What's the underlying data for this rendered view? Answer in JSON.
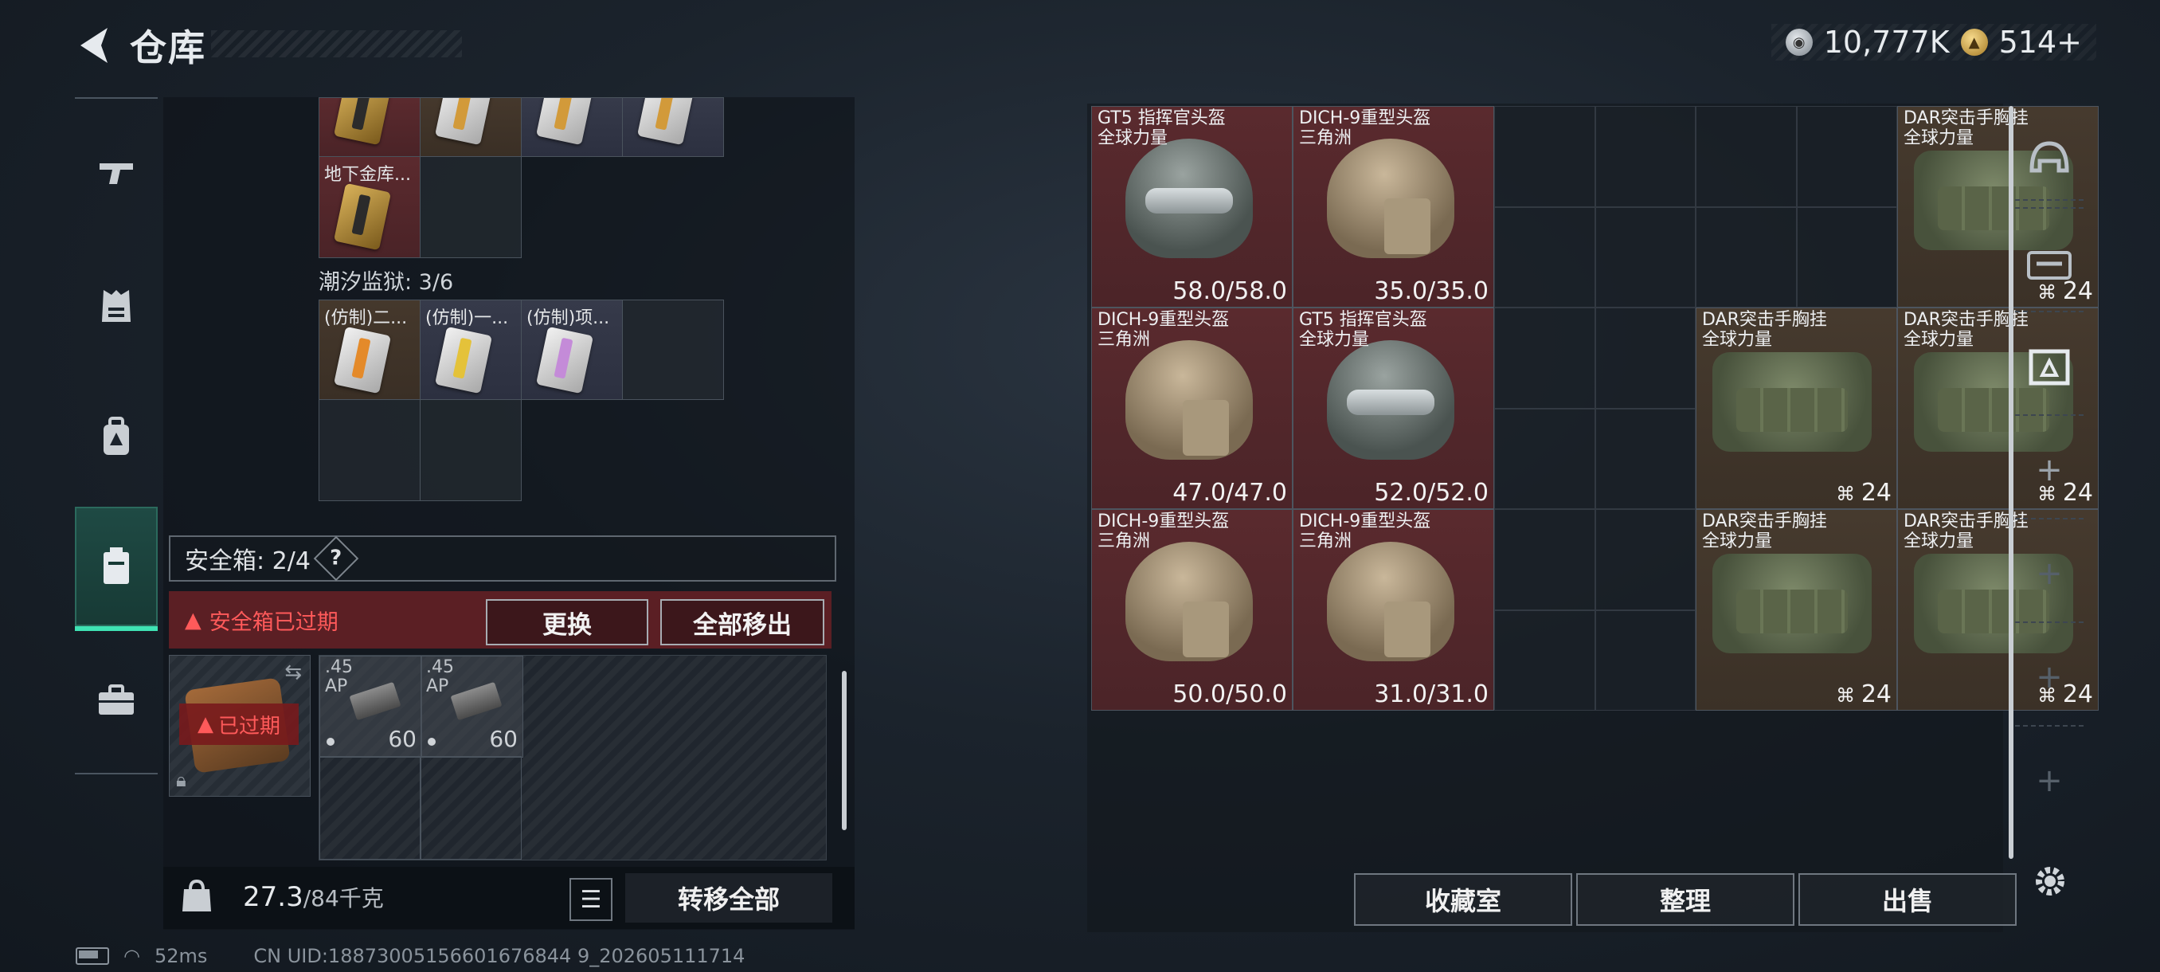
{
  "header": {
    "title": "仓库"
  },
  "currency": {
    "silver": "10,777K",
    "gold": "514+"
  },
  "left": {
    "top_row_label": "地下金库...",
    "section_prison": "潮汐监狱: 3/6",
    "prison_items": [
      "(仿制)二...",
      "(仿制)一...",
      "(仿制)项..."
    ],
    "safe_box": "安全箱: 2/4",
    "help": "?",
    "expired_warning": "安全箱已过期",
    "replace_button": "更换",
    "move_all_out_button": "全部移出",
    "case_expired": "已过期",
    "ammo": [
      {
        "label_line1": ".45",
        "label_line2": "AP",
        "count": "60"
      },
      {
        "label_line1": ".45",
        "label_line2": "AP",
        "count": "60"
      }
    ],
    "weight_current": "27.3",
    "weight_max": "/84千克",
    "transfer_all_button": "转移全部"
  },
  "items": [
    {
      "name": "GT5 指挥官头盔",
      "sub": "全球力量",
      "value": "58.0/58.0",
      "kind": "gt5"
    },
    {
      "name": "DICH-9重型头盔",
      "sub": "三角洲",
      "value": "35.0/35.0",
      "kind": "dich"
    },
    {
      "name": "DAR突击手胸挂",
      "sub": "全球力量",
      "value": "24",
      "kind": "bag"
    },
    {
      "name": "DICH-9重型头盔",
      "sub": "三角洲",
      "value": "47.0/47.0",
      "kind": "dich"
    },
    {
      "name": "GT5 指挥官头盔",
      "sub": "全球力量",
      "value": "52.0/52.0",
      "kind": "gt5"
    },
    {
      "name": "DAR突击手胸挂",
      "sub": "全球力量",
      "value": "24",
      "kind": "bag"
    },
    {
      "name": "DAR突击手胸挂",
      "sub": "全球力量",
      "value": "24",
      "kind": "bag"
    },
    {
      "name": "DICH-9重型头盔",
      "sub": "三角洲",
      "value": "50.0/50.0",
      "kind": "dich"
    },
    {
      "name": "DICH-9重型头盔",
      "sub": "三角洲",
      "value": "31.0/31.0",
      "kind": "dich"
    },
    {
      "name": "DAR突击手胸挂",
      "sub": "全球力量",
      "value": "24",
      "kind": "bag"
    },
    {
      "name": "DAR突击手胸挂",
      "sub": "全球力量",
      "value": "24",
      "kind": "bag"
    }
  ],
  "actions": {
    "collection": "收藏室",
    "organize": "整理",
    "sell": "出售"
  },
  "status": {
    "ping": "52ms",
    "uid": "CN UID:18873005156601676844 9_202605111714"
  },
  "icons": [
    "back-arrow-icon",
    "silver-coin-icon",
    "gold-coin-icon",
    "gun-icon",
    "vest-icon",
    "backpack-icon",
    "safe-case-icon",
    "briefcase-icon",
    "helmet-slot-icon",
    "gun-case-icon",
    "loot-box-icon",
    "gear-icon",
    "lock-icon",
    "kg-weight-icon",
    "list-icon",
    "warning-icon",
    "swap-icon",
    "wifi-icon",
    "battery-icon"
  ]
}
